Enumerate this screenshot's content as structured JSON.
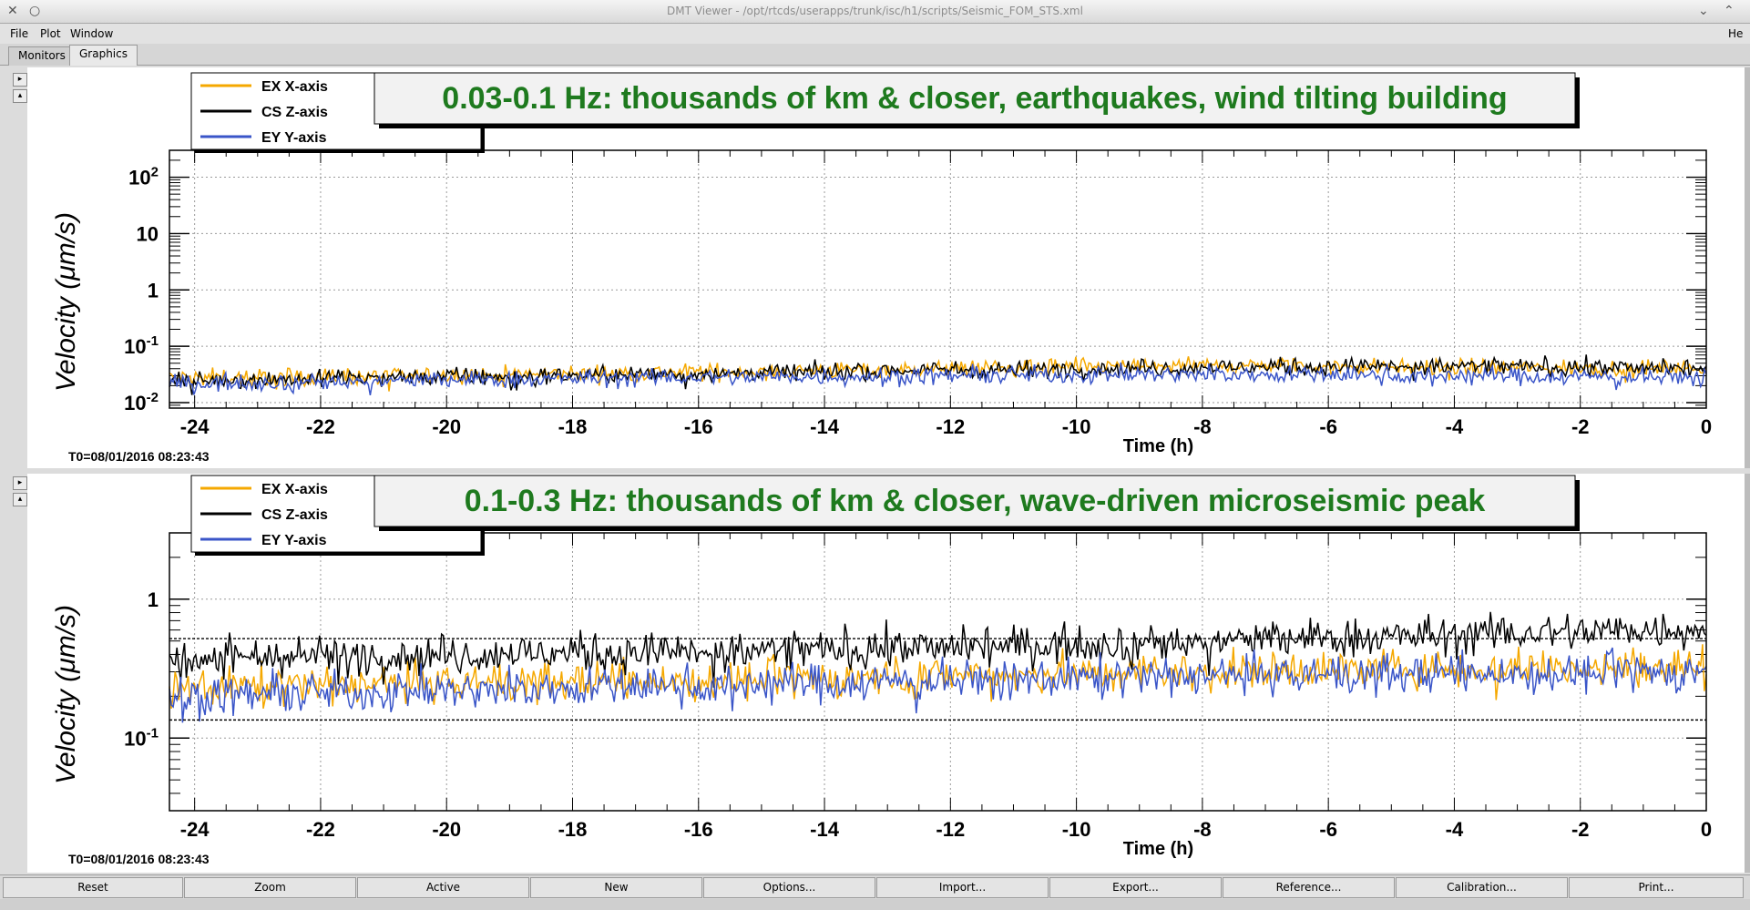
{
  "window": {
    "title": "DMT Viewer - /opt/rtcds/userapps/trunk/isc/h1/scripts/Seismic_FOM_STS.xml",
    "help_label": "He"
  },
  "menu": {
    "file": "File",
    "plot": "Plot",
    "window": "Window"
  },
  "tabs": [
    {
      "label": "Monitors"
    },
    {
      "label": "Graphics"
    }
  ],
  "step_buttons": {
    "next": "▸",
    "prev": "▴"
  },
  "legend_entries": [
    {
      "label": "EX X-axis",
      "color": "#f5a800"
    },
    {
      "label": "CS Z-axis",
      "color": "#000000"
    },
    {
      "label": "EY Y-axis",
      "color": "#3a55c8"
    }
  ],
  "chart_data": [
    {
      "type": "line",
      "title": "0.03-0.1 Hz: thousands of km & closer, earthquakes, wind tilting building",
      "xlabel": "Time (h)",
      "ylabel": "Velocity  (μm/s)",
      "t0_label": "T0=08/01/2016 08:23:43",
      "xlim": [
        -24.4,
        0
      ],
      "ylim": [
        0.008,
        300
      ],
      "yscale": "log",
      "grid": true,
      "legend_position": "top-left",
      "x_ticks": [
        -24,
        -22,
        -20,
        -18,
        -16,
        -14,
        -12,
        -10,
        -8,
        -6,
        -4,
        -2,
        0
      ],
      "y_ticks": [
        {
          "value": 0.01,
          "base": "10",
          "exp": "-2"
        },
        {
          "value": 0.1,
          "base": "10",
          "exp": "-1"
        },
        {
          "value": 1,
          "base": "1",
          "exp": ""
        },
        {
          "value": 10,
          "base": "10",
          "exp": ""
        },
        {
          "value": 100,
          "base": "10",
          "exp": "2"
        }
      ],
      "series": [
        {
          "name": "EX X-axis",
          "color": "#f5a800",
          "x": [
            -24,
            -20,
            -16,
            -12,
            -8,
            -4,
            0
          ],
          "values": [
            0.028,
            0.03,
            0.035,
            0.04,
            0.045,
            0.042,
            0.04
          ]
        },
        {
          "name": "CS Z-axis",
          "color": "#000000",
          "x": [
            -24,
            -20,
            -16,
            -12,
            -8,
            -4,
            0
          ],
          "values": [
            0.025,
            0.028,
            0.033,
            0.038,
            0.042,
            0.045,
            0.04
          ]
        },
        {
          "name": "EY Y-axis",
          "color": "#3a55c8",
          "x": [
            -24,
            -20,
            -16,
            -12,
            -8,
            -4,
            0
          ],
          "values": [
            0.022,
            0.025,
            0.028,
            0.03,
            0.032,
            0.03,
            0.028
          ]
        }
      ]
    },
    {
      "type": "line",
      "title": "0.1-0.3 Hz: thousands of km & closer, wave-driven microseismic peak",
      "xlabel": "Time (h)",
      "ylabel": "Velocity  (μm/s)",
      "t0_label": "T0=08/01/2016 08:23:43",
      "xlim": [
        -24.4,
        0
      ],
      "ylim": [
        0.03,
        3
      ],
      "yscale": "log",
      "grid": true,
      "legend_position": "top-left",
      "x_ticks": [
        -24,
        -22,
        -20,
        -18,
        -16,
        -14,
        -12,
        -10,
        -8,
        -6,
        -4,
        -2,
        0
      ],
      "y_ticks": [
        {
          "value": 0.1,
          "base": "10",
          "exp": "-1"
        },
        {
          "value": 1,
          "base": "1",
          "exp": ""
        }
      ],
      "series": [
        {
          "name": "EX X-axis",
          "color": "#f5a800",
          "x": [
            -24,
            -20,
            -16,
            -12,
            -8,
            -4,
            0
          ],
          "values": [
            0.23,
            0.25,
            0.26,
            0.28,
            0.3,
            0.32,
            0.33
          ]
        },
        {
          "name": "CS Z-axis",
          "color": "#000000",
          "x": [
            -24,
            -20,
            -16,
            -12,
            -8,
            -4,
            0
          ],
          "values": [
            0.38,
            0.4,
            0.42,
            0.45,
            0.5,
            0.55,
            0.62
          ]
        },
        {
          "name": "EY Y-axis",
          "color": "#3a55c8",
          "x": [
            -24,
            -20,
            -16,
            -12,
            -8,
            -4,
            0
          ],
          "values": [
            0.2,
            0.22,
            0.24,
            0.26,
            0.28,
            0.29,
            0.3
          ]
        }
      ]
    }
  ],
  "bottom_buttons": [
    {
      "label": "Reset"
    },
    {
      "label": "Zoom"
    },
    {
      "label": "Active"
    },
    {
      "label": "New"
    },
    {
      "label": "Options..."
    },
    {
      "label": "Import..."
    },
    {
      "label": "Export..."
    },
    {
      "label": "Reference..."
    },
    {
      "label": "Calibration..."
    },
    {
      "label": "Print..."
    }
  ]
}
